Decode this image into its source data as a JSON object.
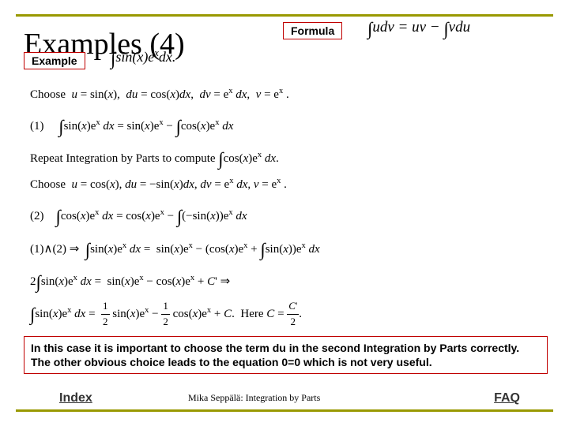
{
  "title": "Examples (4)",
  "exampleLabel": "Example",
  "formulaLabel": "Formula",
  "formulaMath": "∫udv = uv − ∫vdu",
  "exampleMath": "∫sin(x)eˣdx.",
  "math": {
    "l1": "Choose  u = sin(x),  du = cos(x)dx,  dv = eˣ dx,  v = eˣ .",
    "l2": "(1)     ∫sin(x)eˣ dx = sin(x)eˣ − ∫cos(x)eˣ dx",
    "l3": "Repeat Integration by Parts to compute ∫cos(x)eˣ dx.",
    "l4": "Choose  u = cos(x), du = −sin(x)dx, dv = eˣ dx, v = eˣ .",
    "l5": "(2)    ∫cos(x)eˣ dx = cos(x)eˣ − ∫(−sin(x))eˣ dx",
    "l6": "(1)∧(2) ⇒  ∫sin(x)eˣ dx =  sin(x)eˣ − (cos(x)eˣ + ∫sin(x))eˣ dx",
    "l7": "2∫sin(x)eˣ dx =  sin(x)eˣ − cos(x)eˣ + C' ⇒",
    "l8a": "∫sin(x)eˣ dx =  ",
    "l8b": "½ sin(x)eˣ − ½ cos(x)eˣ + C.  Here C = C'/2."
  },
  "note": "In this case it is important to choose the term du in the second Integration by Parts correctly.  The other obvious choice leads to the equation 0=0 which is not very useful.",
  "footer": {
    "index": "Index",
    "center": "Mika Seppälä: Integration by Parts",
    "faq": "FAQ"
  }
}
